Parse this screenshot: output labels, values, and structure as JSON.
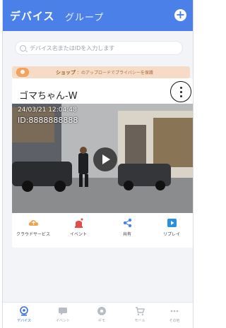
{
  "header": {
    "tab_devices": "デバイス",
    "tab_groups": "グループ",
    "add_icon": "plus-circle-icon",
    "background": "#4a80e8"
  },
  "search": {
    "placeholder": "デバイス名またはIDを入力します"
  },
  "banner": {
    "shop_label": "ショップ",
    "text": "：のアップロードでプライバシーを保護"
  },
  "device": {
    "name": "ゴマちゃん-W",
    "timestamp": "24/03/21 12:04:48",
    "id_label": "ID:8888888888",
    "actions": [
      {
        "label": "クラウドサービス",
        "icon": "cloud-upload-icon",
        "color": "#f0a34a"
      },
      {
        "label": "イベント",
        "icon": "alarm-bell-icon",
        "color": "#e84a4a"
      },
      {
        "label": "共有",
        "icon": "share-icon",
        "color": "#4a80e8"
      },
      {
        "label": "リプレイ",
        "icon": "replay-icon",
        "color": "#2a8fe0"
      }
    ]
  },
  "bottom_nav": [
    {
      "label": "デバイス",
      "icon": "camera-icon",
      "active": true
    },
    {
      "label": "イベント",
      "icon": "chat-icon",
      "active": false
    },
    {
      "label": "ギモ",
      "icon": "disc-icon",
      "active": false
    },
    {
      "label": "モール",
      "icon": "cart-icon",
      "active": false
    },
    {
      "label": "その他",
      "icon": "more-icon",
      "active": false
    }
  ]
}
